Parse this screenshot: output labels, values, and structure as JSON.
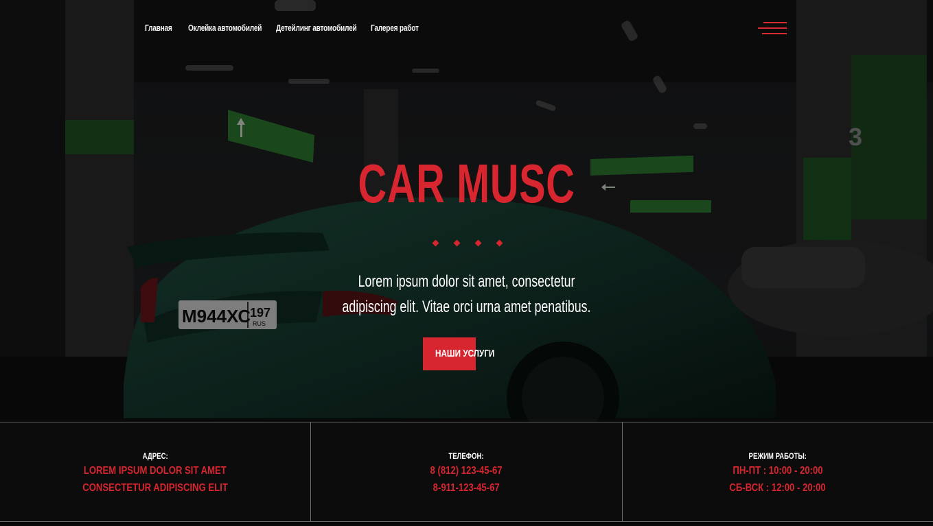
{
  "nav": {
    "links": [
      {
        "label": "Главная"
      },
      {
        "label": "Оклейка автомобилей"
      },
      {
        "label": "Детейлинг автомобилей"
      },
      {
        "label": "Галерея работ"
      }
    ]
  },
  "hero": {
    "title": "CAR MUSC",
    "text_line1": "Lorem ipsum dolor sit amet, consectetur",
    "text_line2": "adipiscing elit. Vitae orci urna amet penatibus.",
    "cta_label": "НАШИ УСЛУГИ"
  },
  "background": {
    "plate_text": "М944ХС",
    "plate_region": "197",
    "plate_country": "RUS",
    "pillar_number": "3"
  },
  "info": {
    "address": {
      "label": "АДРЕС:",
      "line1": "LOREM IPSUM DOLOR SIT AMET",
      "line2": "CONSECTETUR ADIPISCING ELIT"
    },
    "phone": {
      "label": "ТЕЛЕФОН:",
      "line1": "8 (812) 123-45-67",
      "line2": "8-911-123-45-67"
    },
    "hours": {
      "label": "РЕЖИМ РАБОТЫ:",
      "line1": "ПН-ПТ : 10:00 - 20:00",
      "line2": "СБ-ВСК : 12:00 - 20:00"
    }
  },
  "colors": {
    "accent": "#d7262f",
    "background": "#0b0b0c",
    "text": "#ffffff"
  },
  "icons": {
    "menu": "hamburger-menu-icon",
    "separator": "diamond-icon"
  }
}
